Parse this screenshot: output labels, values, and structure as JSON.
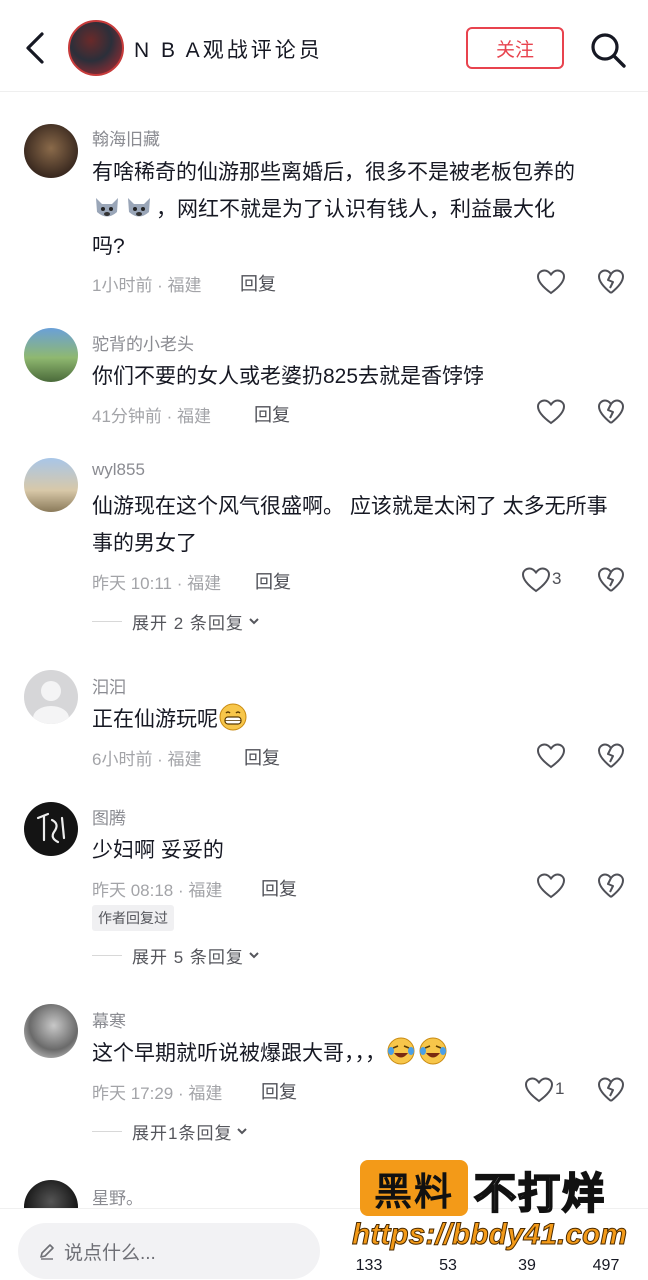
{
  "header": {
    "title": "N B A观战评论员",
    "follow_label": "关注"
  },
  "comments": [
    {
      "user": "翰海旧藏",
      "text_part1": "有啥稀奇的仙游那些离婚后，很多不是被老板包养的",
      "text_part2": "，网红不就是为了认识有钱人，利益最大化",
      "text_part3": "吗?",
      "meta": "1小时前 · 福建",
      "reply_label": "回复"
    },
    {
      "user": "驼背的小老头",
      "text": "你们不要的女人或老婆扔825去就是香饽饽",
      "meta": "41分钟前 · 福建",
      "reply_label": "回复"
    },
    {
      "user": "wyl855",
      "text": "仙游现在这个风气很盛啊。 应该就是太闲了 太多无所事事的男女了",
      "meta": "昨天 10:11 · 福建",
      "reply_label": "回复",
      "likes": "3",
      "expand": "展开 2 条回复"
    },
    {
      "user": "汩汩",
      "text": "正在仙游玩呢",
      "meta": "6小时前 · 福建",
      "reply_label": "回复"
    },
    {
      "user": "图腾",
      "text": "少妇啊 妥妥的",
      "meta": "昨天 08:18 · 福建",
      "reply_label": "回复",
      "author_tag": "作者回复过",
      "expand": "展开 5 条回复"
    },
    {
      "user": "幕寒",
      "text": "这个早期就听说被爆跟大哥，，，",
      "meta": "昨天 17:29 · 福建",
      "reply_label": "回复",
      "likes": "1",
      "expand": "展开1条回复"
    },
    {
      "user": "星野。"
    }
  ],
  "bottom": {
    "input_placeholder": "说点什么...",
    "stats": [
      "133",
      "53",
      "39",
      "497"
    ]
  },
  "watermark": {
    "box": "黑料",
    "text": "不打烊",
    "url": "https://bbdy41.com"
  },
  "colors": {
    "accent": "#e8434e",
    "watermark_orange": "#f39a18"
  }
}
